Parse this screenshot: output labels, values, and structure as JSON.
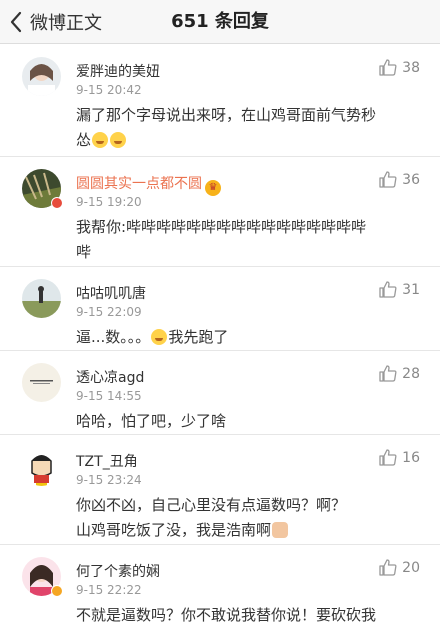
{
  "nav": {
    "back_label": "微博正文",
    "title": "651 条回复"
  },
  "comments": [
    {
      "name": "爱胖迪的美妞",
      "time": "9-15 20:42",
      "likes": "38",
      "text1": "漏了那个字母说出来呀，在山鸡哥面前气势秒",
      "text2": "怂"
    },
    {
      "name": "圆圆其实一点都不圆",
      "time": "9-15 19:20",
      "likes": "36",
      "text1": "我帮你:哔哔哔哔哔哔哔哔哔哔哔哔哔哔哔哔",
      "text2": "哔"
    },
    {
      "name": "咕咕叽叽唐",
      "time": "9-15 22:09",
      "likes": "31",
      "text1": "逼...数。。。",
      "text2": "我先跑了"
    },
    {
      "name": "透心凉agd",
      "time": "9-15 14:55",
      "likes": "28",
      "text1": "哈哈，怕了吧，少了啥"
    },
    {
      "name": "TZT_丑角",
      "time": "9-15 23:24",
      "likes": "16",
      "text1": "你凶不凶，自己心里没有点逼数吗？啊？",
      "text2": "山鸡哥吃饭了没，我是浩南啊"
    },
    {
      "name": "何了个素的娴",
      "time": "9-15 22:22",
      "likes": "20",
      "text1": "不就是逼数吗？你不敢说我替你说！要砍砍我"
    }
  ],
  "colors": {
    "orange_name": "#eb7350",
    "badge_vip": "#f5a623"
  },
  "icons": {
    "back": "chevron-left-icon",
    "like": "thumbs-up-icon"
  }
}
